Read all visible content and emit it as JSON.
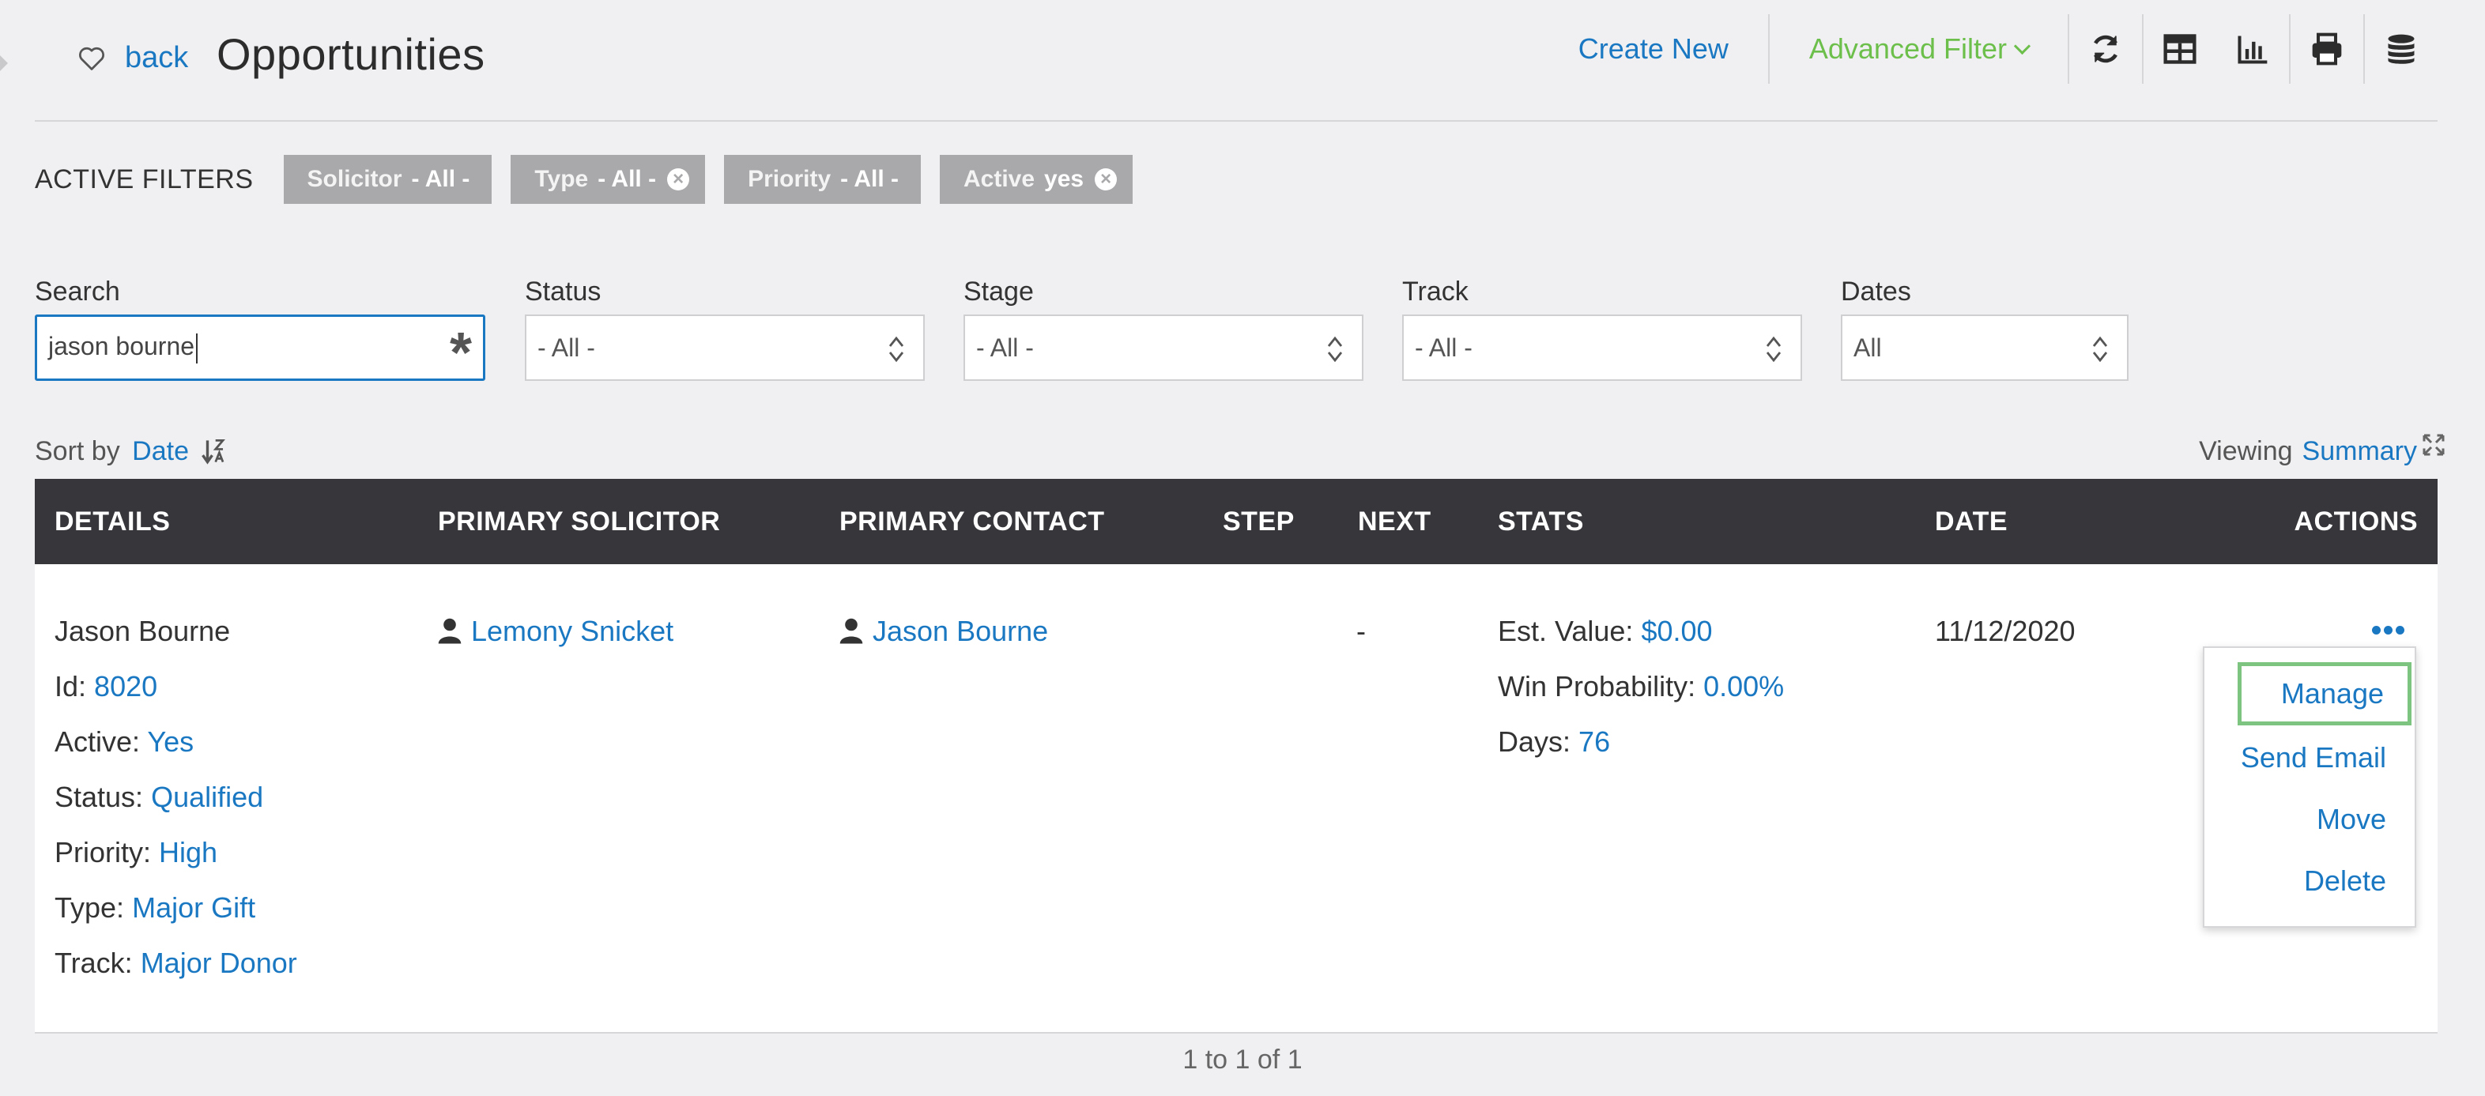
{
  "header": {
    "back_label": "back",
    "title": "Opportunities",
    "create_new_label": "Create New",
    "advanced_filter_label": "Advanced Filter",
    "icons": [
      "refresh-icon",
      "table-icon",
      "chart-icon",
      "print-icon",
      "database-icon"
    ]
  },
  "filters": {
    "label": "ACTIVE FILTERS",
    "chips": [
      {
        "key": "Solicitor",
        "value": "- All -",
        "removable": false
      },
      {
        "key": "Type",
        "value": "- All -",
        "removable": true
      },
      {
        "key": "Priority",
        "value": "- All -",
        "removable": false
      },
      {
        "key": "Active",
        "value": "yes",
        "removable": true
      }
    ]
  },
  "search": {
    "label": "Search",
    "value": "jason bourne"
  },
  "selects": [
    {
      "label": "Status",
      "value": "- All -"
    },
    {
      "label": "Stage",
      "value": "- All -"
    },
    {
      "label": "Track",
      "value": "- All -"
    },
    {
      "label": "Dates",
      "value": "All"
    }
  ],
  "sort": {
    "prefix": "Sort by",
    "field": "Date"
  },
  "viewing": {
    "prefix": "Viewing",
    "mode": "Summary"
  },
  "table": {
    "columns": [
      "DETAILS",
      "PRIMARY SOLICITOR",
      "PRIMARY CONTACT",
      "STEP",
      "NEXT",
      "STATS",
      "DATE",
      "ACTIONS"
    ],
    "row": {
      "name": "Jason Bourne",
      "details": [
        {
          "label": "Id:",
          "value": "8020"
        },
        {
          "label": "Active:",
          "value": "Yes"
        },
        {
          "label": "Status:",
          "value": "Qualified"
        },
        {
          "label": "Priority:",
          "value": "High"
        },
        {
          "label": "Type:",
          "value": "Major Gift"
        },
        {
          "label": "Track:",
          "value": "Major Donor"
        }
      ],
      "solicitor": "Lemony Snicket",
      "contact": "Jason Bourne",
      "next": "-",
      "stats": [
        {
          "label": "Est. Value:",
          "value": "$0.00"
        },
        {
          "label": "Win Probability:",
          "value": "0.00%"
        },
        {
          "label": "Days:",
          "value": "76"
        }
      ],
      "date": "11/12/2020"
    }
  },
  "actions_menu": [
    "Manage",
    "Send Email",
    "Move",
    "Delete"
  ],
  "pagination": "1 to 1 of 1",
  "colors": {
    "link": "#1a78c2",
    "accent_green": "#6cbf4a",
    "header_bg": "#37373b",
    "chip_bg": "#a9a9ab",
    "highlight_border": "#7cc47f"
  }
}
